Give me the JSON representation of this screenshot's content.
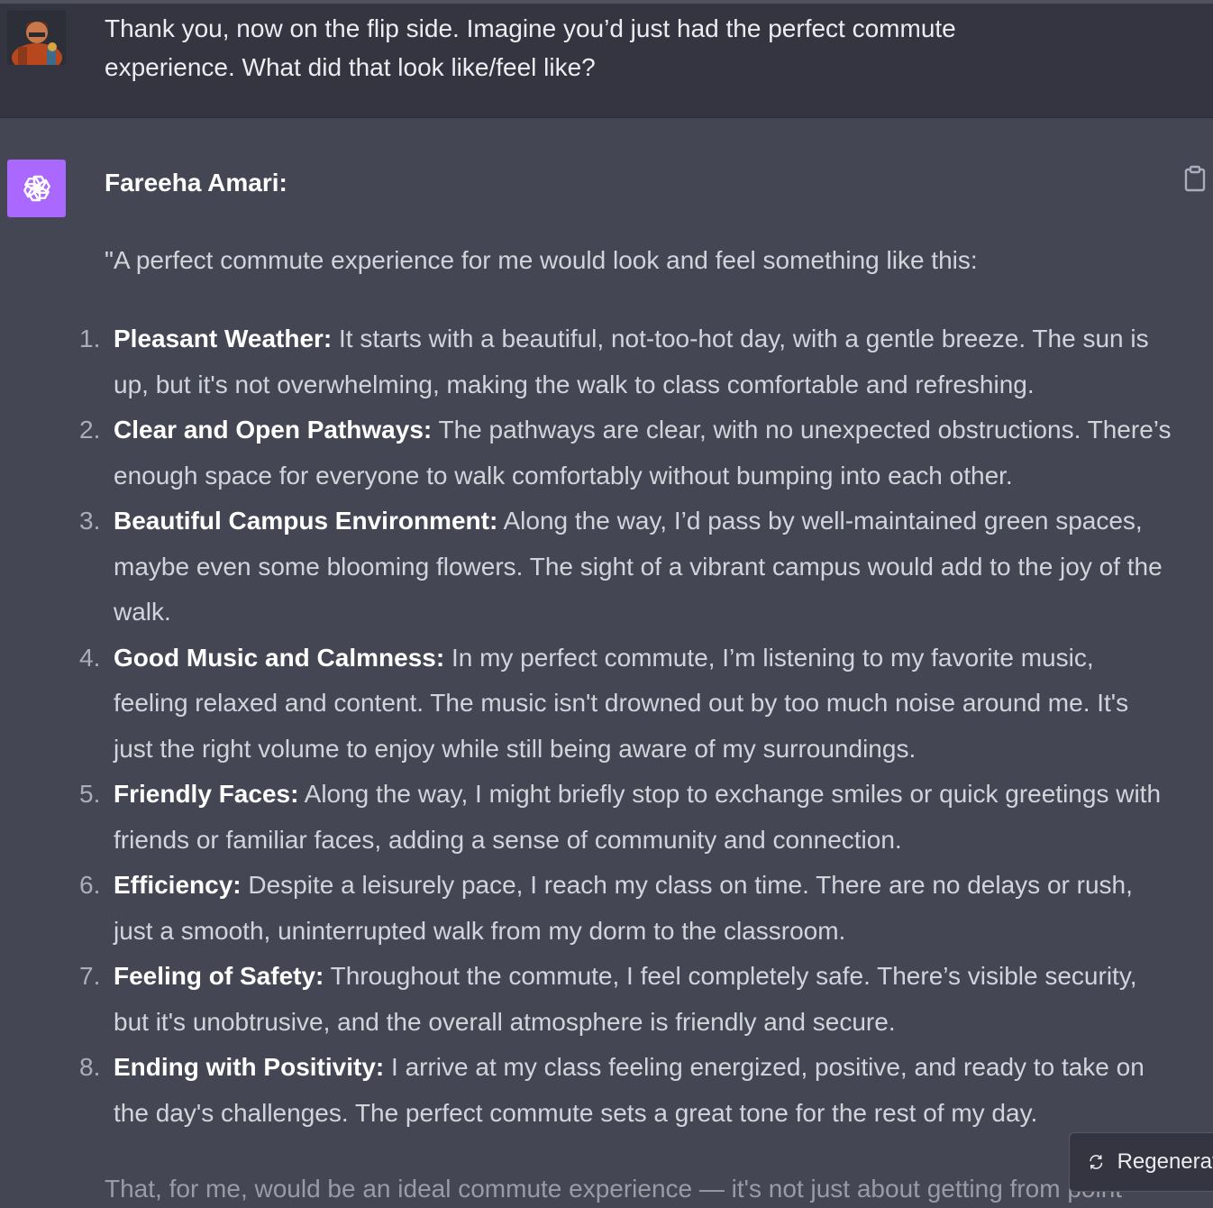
{
  "user_message": {
    "text": "Thank you, now on the flip side. Imagine you’d just had the perfect commute experience. What did that look like/feel like?"
  },
  "assistant_message": {
    "speaker": "Fareeha Amari:",
    "intro": "\"A perfect commute experience for me would look and feel something like this:",
    "items": [
      {
        "num": "1.",
        "title": "Pleasant Weather:",
        "text": " It starts with a beautiful, not-too-hot day, with a gentle breeze. The sun is up, but it's not overwhelming, making the walk to class comfortable and refreshing."
      },
      {
        "num": "2.",
        "title": "Clear and Open Pathways:",
        "text": " The pathways are clear, with no unexpected obstructions. There’s enough space for everyone to walk comfortably without bumping into each other."
      },
      {
        "num": "3.",
        "title": "Beautiful Campus Environment:",
        "text": " Along the way, I’d pass by well-maintained green spaces, maybe even some blooming flowers. The sight of a vibrant campus would add to the joy of the walk."
      },
      {
        "num": "4.",
        "title": "Good Music and Calmness:",
        "text": " In my perfect commute, I’m listening to my favorite music, feeling relaxed and content. The music isn't drowned out by too much noise around me. It's just the right volume to enjoy while still being aware of my surroundings."
      },
      {
        "num": "5.",
        "title": "Friendly Faces:",
        "text": " Along the way, I might briefly stop to exchange smiles or quick greetings with friends or familiar faces, adding a sense of community and connection."
      },
      {
        "num": "6.",
        "title": "Efficiency:",
        "text": " Despite a leisurely pace, I reach my class on time. There are no delays or rush, just a smooth, uninterrupted walk from my dorm to the classroom."
      },
      {
        "num": "7.",
        "title": "Feeling of Safety:",
        "text": " Throughout the commute, I feel completely safe. There’s visible security, but it's unobtrusive, and the overall atmosphere is friendly and secure."
      },
      {
        "num": "8.",
        "title": "Ending with Positivity:",
        "text": " I arrive at my class feeling energized, positive, and ready to take on the day's challenges. The perfect commute sets a great tone for the rest of my day."
      }
    ],
    "outro": "That, for me, would be an ideal commute experience — it's not just about getting from point"
  },
  "controls": {
    "regenerate_label": "Regenerate",
    "copy_icon": "clipboard-icon",
    "regenerate_icon": "refresh-icon"
  },
  "colors": {
    "user_bg": "#343541",
    "assistant_bg": "#444654",
    "bot_avatar": "#ab68ff"
  }
}
